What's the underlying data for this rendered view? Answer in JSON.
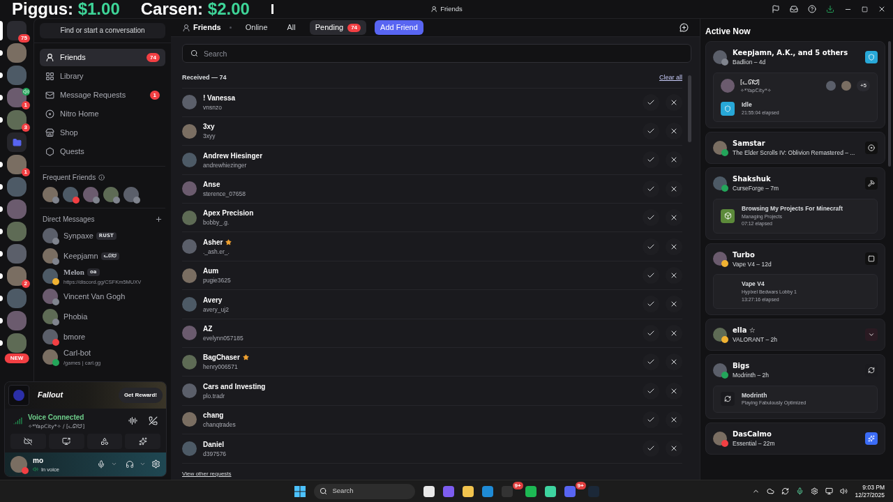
{
  "overlay": {
    "scores": [
      {
        "label": "Piggus:",
        "amount": "$1.00"
      },
      {
        "label": "Carsen:",
        "amount": "$2.00"
      }
    ],
    "cursor": "I"
  },
  "window": {
    "title": "Friends"
  },
  "servers": [
    {
      "kind": "home",
      "badge": "75",
      "selected": true
    },
    {
      "kind": "server",
      "selected": false,
      "unread": true
    },
    {
      "kind": "server",
      "selected": false,
      "unread": true
    },
    {
      "kind": "server",
      "badge": "1",
      "selected": false,
      "unread": true,
      "voice": true
    },
    {
      "kind": "server",
      "badge": "3",
      "selected": false,
      "unread": true
    },
    {
      "kind": "folder",
      "selected": false,
      "unread": false
    },
    {
      "kind": "server",
      "badge": "1",
      "selected": false,
      "unread": true
    },
    {
      "kind": "server",
      "selected": false,
      "unread": true
    },
    {
      "kind": "server",
      "selected": false,
      "unread": true
    },
    {
      "kind": "server",
      "selected": false,
      "unread": true
    },
    {
      "kind": "server",
      "selected": false,
      "unread": true
    },
    {
      "kind": "server",
      "badge": "2",
      "selected": false,
      "unread": true
    },
    {
      "kind": "server",
      "selected": false,
      "unread": true
    },
    {
      "kind": "server",
      "selected": false,
      "unread": true
    },
    {
      "kind": "server",
      "selected": false,
      "unread": true,
      "label": "NEW"
    }
  ],
  "sidebar": {
    "search": {
      "placeholder": "Find or start a conversation"
    },
    "nav": [
      {
        "kind": "friends",
        "label": "Friends",
        "badge": "74",
        "selected": true
      },
      {
        "kind": "library",
        "label": "Library",
        "selected": false
      },
      {
        "kind": "requests",
        "label": "Message Requests",
        "badge": "1",
        "selected": false
      },
      {
        "kind": "nitro",
        "label": "Nitro Home",
        "selected": false
      },
      {
        "kind": "shop",
        "label": "Shop",
        "selected": false
      },
      {
        "kind": "quests",
        "label": "Quests",
        "selected": false
      }
    ],
    "frequent_title": "Frequent Friends",
    "frequent": [
      {
        "color": "#80848e"
      },
      {
        "color": "#f23f43"
      },
      {
        "color": "#80848e"
      },
      {
        "color": "#80848e"
      },
      {
        "color": "#80848e"
      }
    ],
    "dm_title": "Direct Messages",
    "dms": [
      {
        "name": "Synpaxe",
        "tag": "RUST",
        "color": "#80848e"
      },
      {
        "name": "Keepjamn",
        "tag": "ᓚᘏᗢ",
        "color": "#80848e"
      },
      {
        "name": "Melon",
        "tag": "oa",
        "subtitle": "https://discord.gg/CSFKm5MUXV",
        "color": "#f0b232"
      },
      {
        "name": "Vincent Van Gogh",
        "color": "#80848e"
      },
      {
        "name": "Phobia",
        "color": "#80848e"
      },
      {
        "name": "bmore",
        "color": "#f23f43"
      },
      {
        "name": "Carl-bot",
        "subtitle": "/games | carl.gg",
        "color": "#23a55a"
      }
    ]
  },
  "promo": {
    "game": "Fallout",
    "button": "Get Reward!"
  },
  "voice": {
    "status": "Voice Connected",
    "channel": "✧*YapCity*✧ / [ᓚᘏᗢ]"
  },
  "user": {
    "name": "mo",
    "status_text": "In voice",
    "color": "#f23f43"
  },
  "tabs": [
    {
      "label": "Online",
      "selected": false
    },
    {
      "label": "All",
      "selected": false
    },
    {
      "label": "Pending",
      "badge": "74",
      "selected": true
    }
  ],
  "friends_heading": "Friends",
  "add_friend": "Add Friend",
  "search": {
    "placeholder": "Search"
  },
  "received": {
    "title": "Received — 74",
    "clear": "Clear all"
  },
  "requests": [
    {
      "name": "! Vanessa",
      "username": "vnsnzo",
      "emblem": false
    },
    {
      "name": "3xy",
      "username": "3xyy",
      "emblem": false
    },
    {
      "name": "Andrew Hiesinger",
      "username": "andrewhiezinger",
      "emblem": false
    },
    {
      "name": "Anse",
      "username": "sterence_07658",
      "emblem": false
    },
    {
      "name": "Apex Precision",
      "username": "bobby_.g.",
      "emblem": false
    },
    {
      "name": "Asher",
      "username": "._ash.er_.",
      "emblem": true
    },
    {
      "name": "Aum",
      "username": "pugie3625",
      "emblem": false
    },
    {
      "name": "Avery",
      "username": "avery_uj2",
      "emblem": false
    },
    {
      "name": "AZ",
      "username": "evelynn057185",
      "emblem": false
    },
    {
      "name": "BagChaser",
      "username": "henry006571",
      "emblem": true
    },
    {
      "name": "Cars and Investing",
      "username": "plo.tradr",
      "emblem": false
    },
    {
      "name": "chang",
      "username": "chanqtrades",
      "emblem": false
    },
    {
      "name": "Daniel",
      "username": "d397576",
      "emblem": false
    }
  ],
  "view_other": "View other requests",
  "active_now": {
    "title": "Active Now",
    "cards": [
      {
        "kind": "badlion",
        "name": "Keepjamn, A.K., and 5 others",
        "activity": "Badlion – 4d",
        "color": "#80848e",
        "details": [
          {
            "kind": "voice",
            "title": "[ᓚᘏᗢ]",
            "subtitle": "✧*YapCity*✧",
            "more": "+5"
          },
          {
            "kind": "app",
            "title": "Idle",
            "lines": [
              "21:55:04 elapsed"
            ]
          }
        ]
      },
      {
        "kind": "oblivion",
        "name": "Samstar",
        "activity": "The Elder Scrolls IV: Oblivion Remastered – ...",
        "color": "#23a55a"
      },
      {
        "kind": "curseforge",
        "name": "Shakshuk",
        "activity": "CurseForge – 7m",
        "color": "#23a55a",
        "details": [
          {
            "kind": "art",
            "title": "Browsing My Projects For Minecraft",
            "lines": [
              "Managing Projects",
              "07:12 elapsed"
            ]
          }
        ]
      },
      {
        "kind": "vape",
        "name": "Turbo",
        "activity": "Vape V4 – 12d",
        "color": "#f0b232",
        "details": [
          {
            "kind": "text",
            "title": "Vape V4",
            "lines": [
              "Hypixel Bedwars Lobby 1",
              "13:27:16 elapsed"
            ]
          }
        ]
      },
      {
        "kind": "valorant",
        "name": "ella ☆",
        "activity": "VALORANT – 2h",
        "color": "#f0b232"
      },
      {
        "kind": "modrinth",
        "name": "Bigs",
        "activity": "Modrinth – 2h",
        "color": "#23a55a",
        "details": [
          {
            "kind": "app",
            "title": "Modrinth",
            "lines": [
              "Playing Fabulously Optimized"
            ]
          }
        ]
      },
      {
        "kind": "essential",
        "name": "DasCalmo",
        "activity": "Essential – 22m",
        "color": "#f23f43"
      }
    ]
  },
  "taskbar": {
    "search": "Search",
    "apps": [
      {
        "kind": "store"
      },
      {
        "kind": "copilot"
      },
      {
        "kind": "files"
      },
      {
        "kind": "browser"
      },
      {
        "kind": "terminal",
        "badge": "9+"
      },
      {
        "kind": "music"
      },
      {
        "kind": "chat"
      },
      {
        "kind": "discord",
        "badge": "9+"
      },
      {
        "kind": "steam"
      }
    ],
    "time": "9:03 PM",
    "date": "12/27/2025"
  }
}
